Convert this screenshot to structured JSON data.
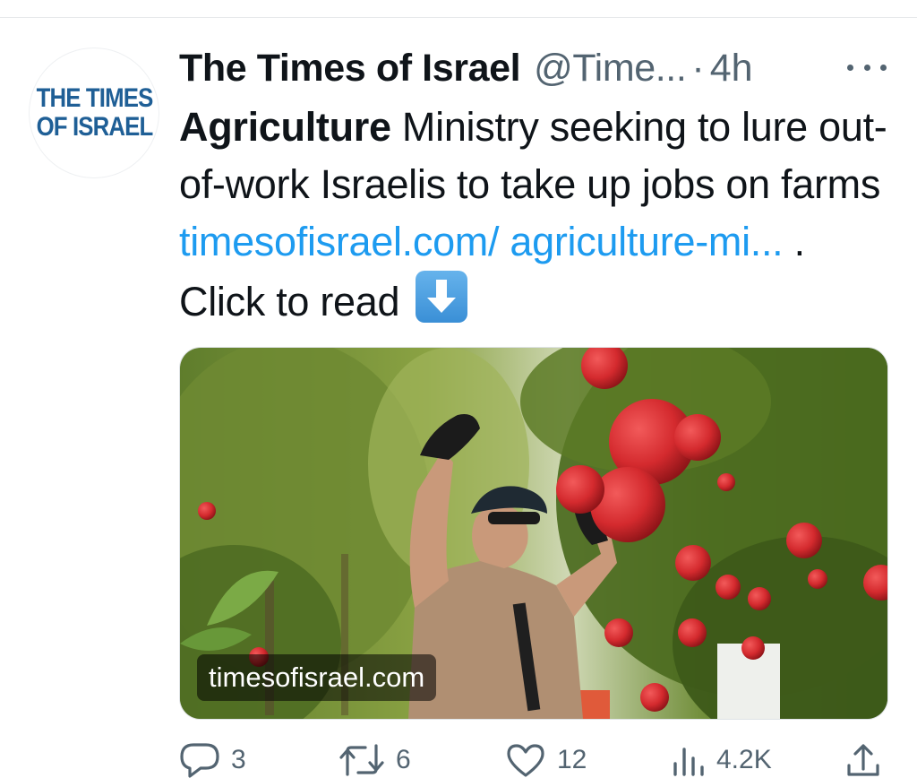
{
  "account": {
    "avatar_line1": "THE TIMES",
    "avatar_line2": "OF ISRAEL",
    "display_name": "The Times of Israel",
    "handle": "@Time...",
    "separator": "·",
    "time": "4h"
  },
  "tweet": {
    "text_bold": "Agriculture",
    "text_main": " Ministry seeking to lure out-of-work Israelis to take up jobs on farms ",
    "link_text": "timesofisrael.com/ agriculture-mi...",
    "text_after": " . Click to read ",
    "emoji": "down-arrow-emoji"
  },
  "card": {
    "domain": "timesofisrael.com",
    "image": "man-picking-pomegranates-photo"
  },
  "actions": {
    "replies": "3",
    "retweets": "6",
    "likes": "12",
    "views": "4.2K"
  },
  "icons": {
    "more": "more-horizontal-icon",
    "reply": "reply-icon",
    "retweet": "retweet-icon",
    "like": "heart-icon",
    "views": "views-icon",
    "share": "share-icon"
  },
  "colors": {
    "text": "#0f1419",
    "secondary": "#536471",
    "link": "#1d9bf0",
    "brand": "#1f5f96"
  }
}
